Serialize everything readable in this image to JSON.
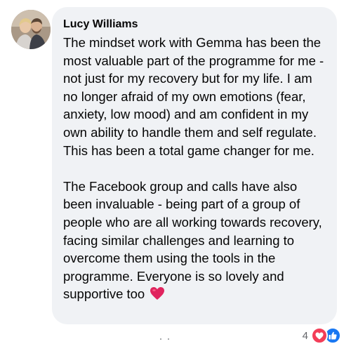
{
  "comment": {
    "author": "Lucy Williams",
    "paragraphs": [
      "The mindset work with Gemma has been the most valuable part of the programme for me - not just for my recovery but for my life. I am no longer afraid of my own emotions (fear, anxiety, low mood) and am confident in my own ability to handle them and self regulate. This has been a total game changer for me.",
      "The Facebook group and calls have also been invaluable - being part of a group of people who are all working towards recovery, facing similar challenges and learning to overcome them using the tools in the programme. Everyone is so lovely and supportive too"
    ],
    "trailing_emoji": "red-heart-emoji"
  },
  "reactions": {
    "count": "4",
    "types": [
      "love",
      "like"
    ]
  },
  "colors": {
    "bubble_bg": "#f0f2f5",
    "text": "#050505",
    "muted": "#65676b",
    "love": "#f33e58",
    "like": "#1877f2",
    "heart_emoji": "#e0245e"
  }
}
